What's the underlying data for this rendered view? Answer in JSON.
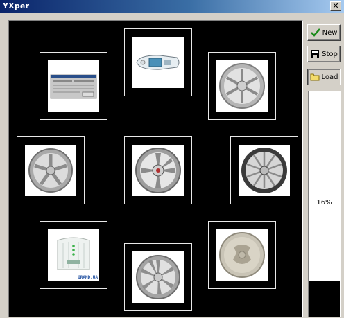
{
  "window": {
    "title": "YXper",
    "close_glyph": "✕"
  },
  "toolbar": {
    "new_label": "New",
    "stop_label": "Stop",
    "load_label": "Load",
    "new_icon": "checkmark-icon",
    "stop_icon": "floppy-disk-icon",
    "load_icon": "folder-icon"
  },
  "progress": {
    "value": 0.16,
    "label": "16%"
  },
  "gallery": {
    "items": [
      {
        "kind": "screenshot"
      },
      {
        "kind": "boat"
      },
      {
        "kind": "wheel"
      },
      {
        "kind": "wheel"
      },
      {
        "kind": "wheel"
      },
      {
        "kind": "wheel"
      },
      {
        "kind": "router",
        "caption": "GRAND.UA"
      },
      {
        "kind": "wheel"
      },
      {
        "kind": "coin"
      }
    ]
  },
  "colors": {
    "title_gradient_start": "#0a246a",
    "title_gradient_end": "#a6caf0",
    "canvas_bg": "#000000",
    "progress_fill": "#000000",
    "progress_empty": "#ffffff",
    "check_green": "#1a8a1a"
  }
}
